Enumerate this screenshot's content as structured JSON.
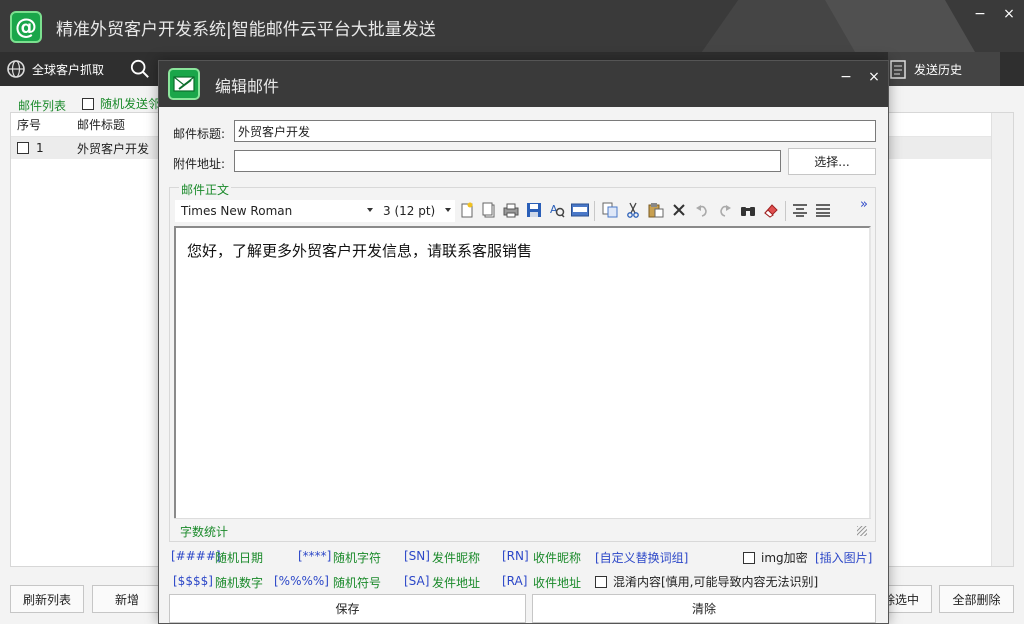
{
  "app": {
    "logo_glyph": "@",
    "title": "精准外贸客户开发系统|智能邮件云平台大批量发送",
    "minimize_glyph": "−",
    "close_glyph": "×"
  },
  "toolbar": {
    "global_crawl_label": "全球客户抓取",
    "send_history_label": "发送历史"
  },
  "mail_list": {
    "group_label": "邮件列表",
    "random_send_label": "随机发送邻",
    "columns": [
      "序号",
      "邮件标题"
    ],
    "rows": [
      {
        "index": "1",
        "title": "外贸客户开发"
      }
    ]
  },
  "bottom_buttons": {
    "refresh": "刷新列表",
    "add": "新增",
    "delete_selected": "除选中",
    "delete_all": "全部删除"
  },
  "dialog": {
    "title": "编辑邮件",
    "minimize_glyph": "−",
    "close_glyph": "×",
    "subject_label": "邮件标题:",
    "subject_value": "外贸客户开发",
    "attachment_label": "附件地址:",
    "attachment_value": "",
    "browse_button": "选择...",
    "body_group_label": "邮件正文",
    "font_name": "Times New Roman",
    "font_size": "3 (12 pt)",
    "more_glyph": "»",
    "body_text": "您好，了解更多外贸客户开发信息，请联系客服销售",
    "word_count_label": "字数统计",
    "variables": [
      {
        "code": "[####]",
        "desc": "随机日期"
      },
      {
        "code": "[****]",
        "desc": "随机字符"
      },
      {
        "code": "[SN]",
        "desc": "发件昵称"
      },
      {
        "code": "[RN]",
        "desc": "收件昵称"
      },
      {
        "code": "[$$$$]",
        "desc": "随机数字"
      },
      {
        "code": "[%%%%]",
        "desc": "随机符号"
      },
      {
        "code": "[SA]",
        "desc": "发件地址"
      },
      {
        "code": "[RA]",
        "desc": "收件地址"
      }
    ],
    "custom_replace_link": "[自定义替换词组]",
    "img_encrypt_label": "img加密",
    "insert_image_link": "[插入图片]",
    "obfuscate_label": "混淆内容[慎用,可能导致内容无法识别]",
    "save_button": "保存",
    "clear_button": "清除"
  },
  "colors": {
    "titlebar": "#3a3a3a",
    "accent_green": "#1a8a2a",
    "link_blue": "#2d48c8",
    "logo_green": "#1aa64a"
  }
}
